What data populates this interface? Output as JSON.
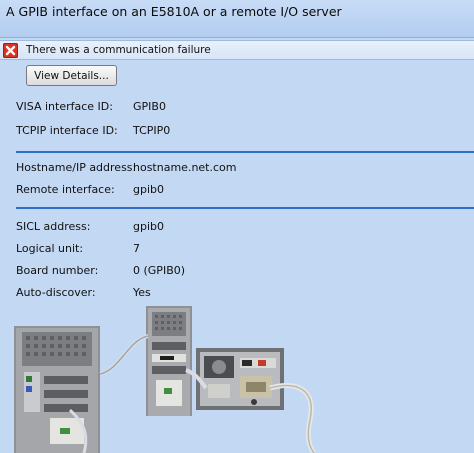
{
  "header": {
    "title": "A GPIB interface on an E5810A or a remote I/O server"
  },
  "status": {
    "message": "There was a communication failure",
    "icon": "error-x-icon",
    "icon_color": "#d93323"
  },
  "actions": {
    "view_details_label": "View Details..."
  },
  "section1": {
    "rows": [
      {
        "label": "VISA interface ID:",
        "value": "GPIB0"
      },
      {
        "label": "TCPIP interface ID:",
        "value": "TCPIP0"
      }
    ]
  },
  "section2": {
    "rows": [
      {
        "label": "Hostname/IP address:",
        "value": "hostname.net.com"
      },
      {
        "label": "Remote interface:",
        "value": "gpib0"
      }
    ]
  },
  "section3": {
    "rows": [
      {
        "label": "SICL address:",
        "value": "gpib0"
      },
      {
        "label": "Logical unit:",
        "value": "7"
      },
      {
        "label": "Board number:",
        "value": "0 (GPIB0)"
      },
      {
        "label": "Auto-discover:",
        "value": "Yes"
      }
    ]
  },
  "colors": {
    "background": "#c3d8f3",
    "separator": "#2d6fc7"
  }
}
